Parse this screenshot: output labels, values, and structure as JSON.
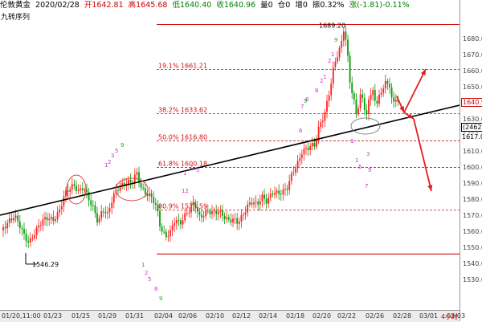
{
  "info_bar": {
    "symbol": "伦敦黄金",
    "date": "2020/02/28",
    "open": "开1642.81",
    "high": "高1645.68",
    "low": "低1640.40",
    "close": "收1640.96",
    "volume": "量0",
    "position": "仓0",
    "increase": "增0",
    "amplitude": "振0.32%",
    "change": "涨(-1.81)-0.11%"
  },
  "indicator_label": "九转序列",
  "price_axis": {
    "ticks": [
      "1680.00",
      "1670.00",
      "1660.00",
      "1650.00",
      "1640.00",
      "1630.00",
      "1620.00",
      "1610.00",
      "1600.00",
      "1590.00",
      "1580.00",
      "1570.00",
      "1560.00",
      "1550.00",
      "1540.00",
      "1530.00"
    ],
    "current_price": "1640.96",
    "count_box": "(2462)",
    "secondary_price": "1617.09"
  },
  "annotations": {
    "high_label": "1689.20",
    "low_label": "1546.29",
    "fib": [
      "19.1% 1661.21",
      "38.2% 1633.62",
      "50.0% 1616.80",
      "61.8% 1600.18",
      "80.9% 1573.59"
    ]
  },
  "date_axis": {
    "labels": [
      "01/20,11:00",
      "01/23",
      "01/25",
      "01/29",
      "01/31",
      "02/04",
      "02/06",
      "02/10",
      "02/12",
      "02/14",
      "02/18",
      "02/20",
      "02/22",
      "02/26",
      "02/28",
      "03/01",
      "03/03"
    ],
    "period": "4小时"
  },
  "colors": {
    "up": "#ff2020",
    "down": "#0a9a0a",
    "trendline": "#000000",
    "fib_line": "#d01010",
    "seq_green": "#22aa22",
    "seq_magenta": "#cc33cc"
  },
  "chart_data": {
    "type": "candlestick",
    "y_range": [
      1525,
      1693
    ],
    "swing_high": 1689.2,
    "swing_low": 1546.29,
    "fib_levels": [
      {
        "ratio": "19.1%",
        "price": 1661.21
      },
      {
        "ratio": "38.2%",
        "price": 1633.62
      },
      {
        "ratio": "50.0%",
        "price": 1616.8
      },
      {
        "ratio": "61.8%",
        "price": 1600.18
      },
      {
        "ratio": "80.9%",
        "price": 1573.59
      }
    ]
  }
}
